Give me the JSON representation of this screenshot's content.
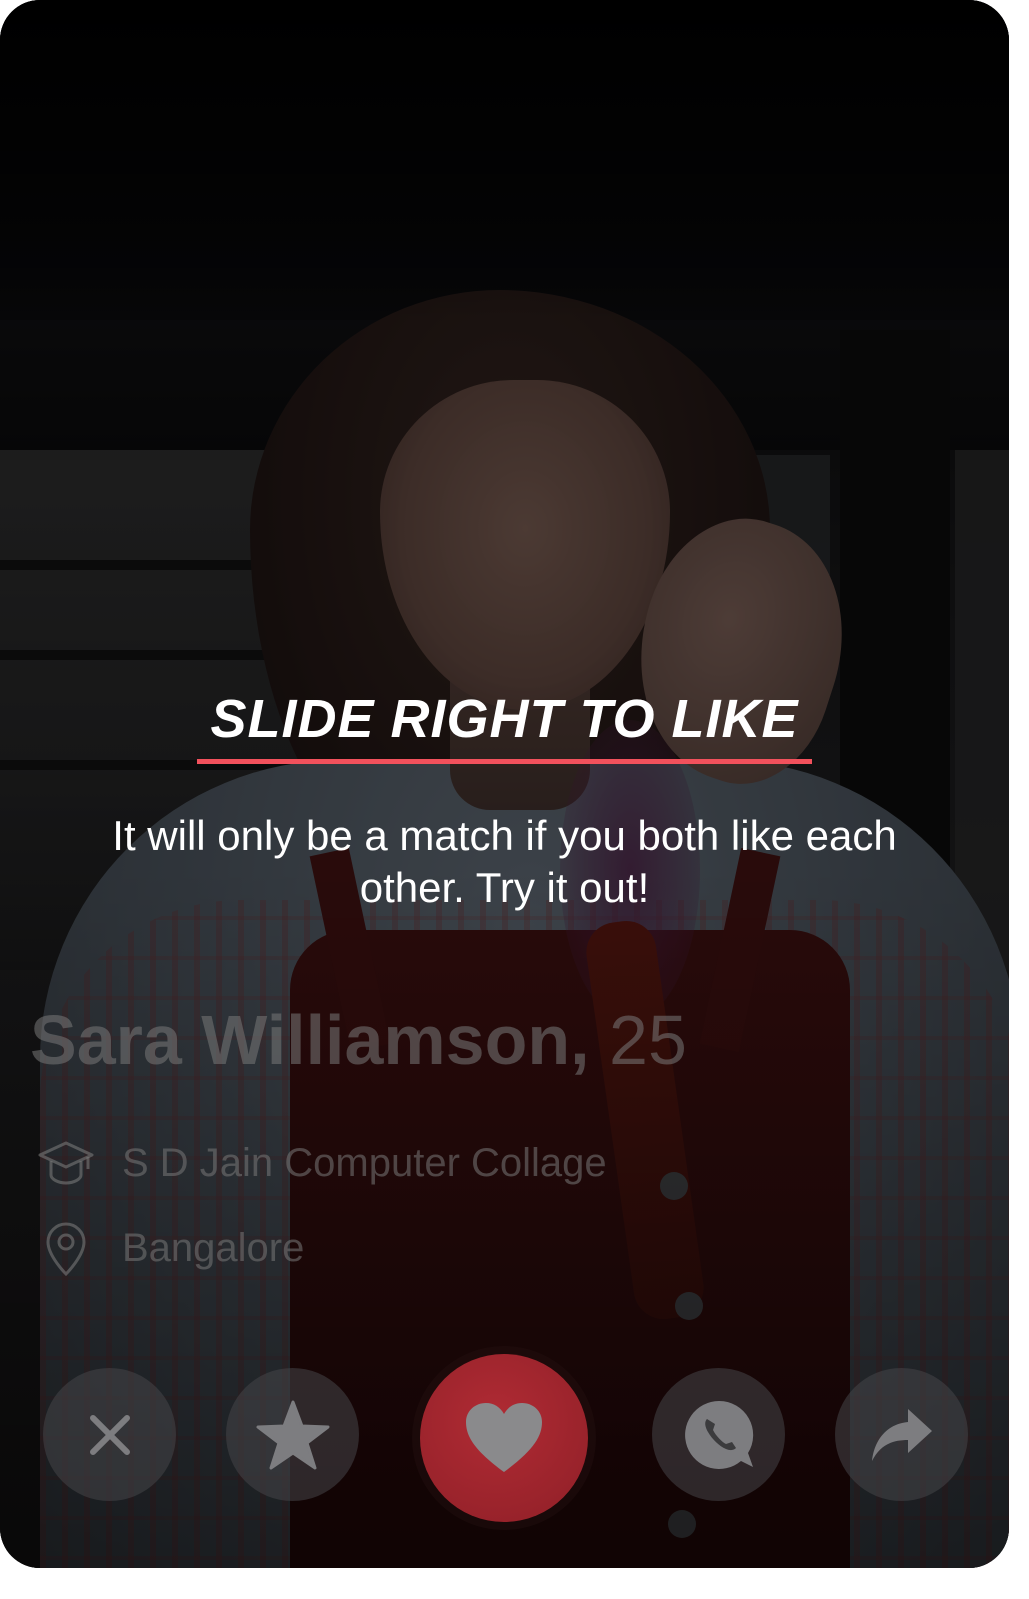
{
  "coach": {
    "title": "SLIDE RIGHT TO LIKE",
    "description": "It will only be a match if you both like each other. Try it out!",
    "accent_color": "#f2515c"
  },
  "profile": {
    "name": "Sara Williamson,",
    "age": "25",
    "school": "S D Jain Computer Collage",
    "city": "Bangalore",
    "school_icon": "graduation-cap-icon",
    "city_icon": "location-pin-icon"
  },
  "actions": [
    {
      "name": "dislike",
      "icon": "close-icon"
    },
    {
      "name": "super-like",
      "icon": "star-icon"
    },
    {
      "name": "like",
      "icon": "heart-icon",
      "color": "#a8262f"
    },
    {
      "name": "chat",
      "icon": "chat-phone-icon"
    },
    {
      "name": "share",
      "icon": "share-arrow-icon"
    }
  ]
}
